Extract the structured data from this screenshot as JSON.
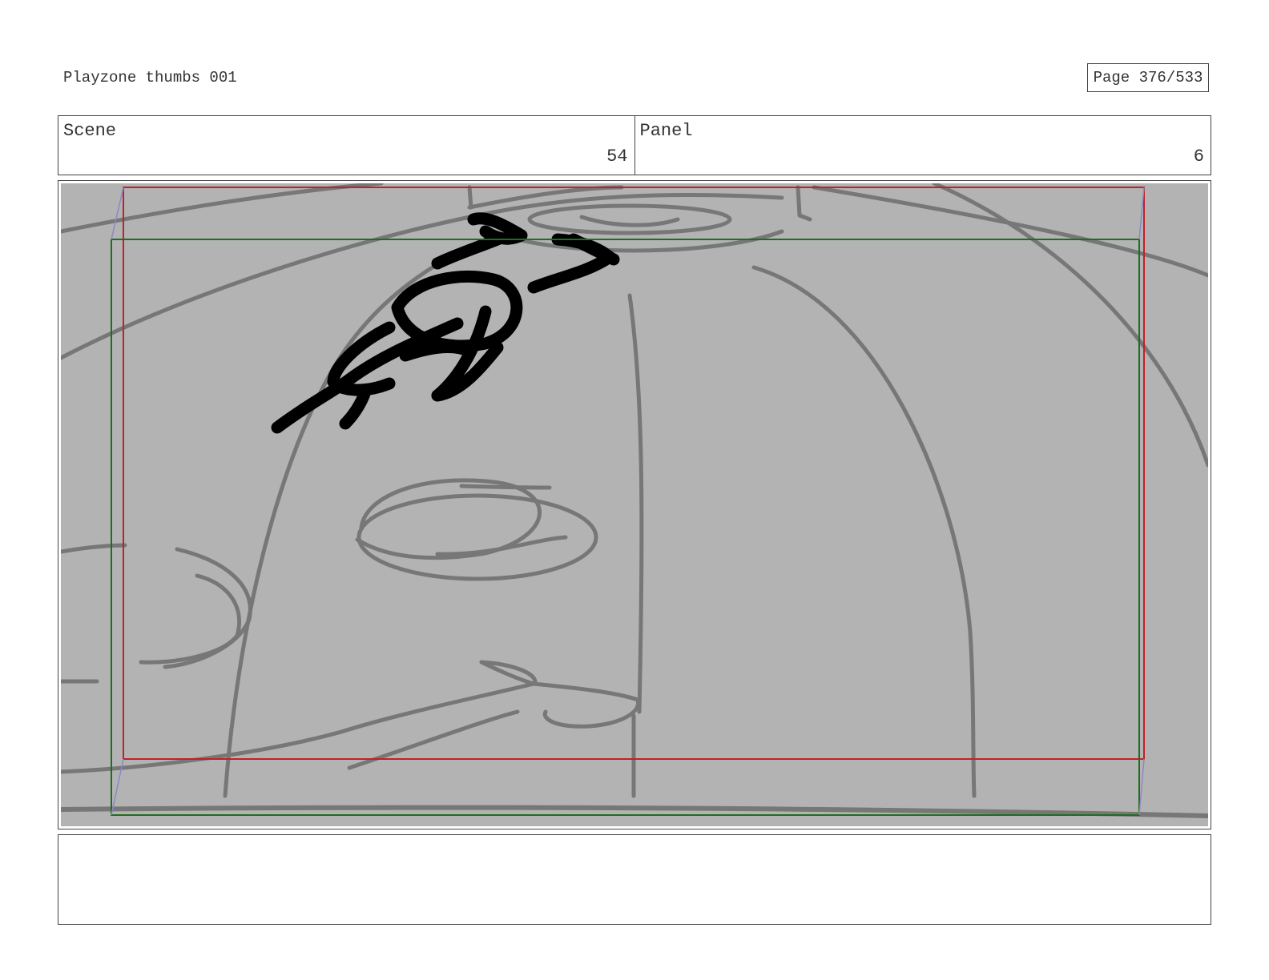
{
  "header": {
    "title": "Playzone thumbs 001",
    "page_label": "Page 376/533"
  },
  "info": {
    "scene_label": "Scene",
    "scene_value": "54",
    "panel_label": "Panel",
    "panel_value": "6"
  },
  "notes": {
    "text": ""
  },
  "colors": {
    "panel_background": "#b3b3b3",
    "sketch_line": "#777777",
    "ink_figure": "#000000",
    "safe_frame_red": "#c0202a",
    "action_frame_green": "#1e6e1e",
    "camera_arrow": "#8a88c8"
  }
}
